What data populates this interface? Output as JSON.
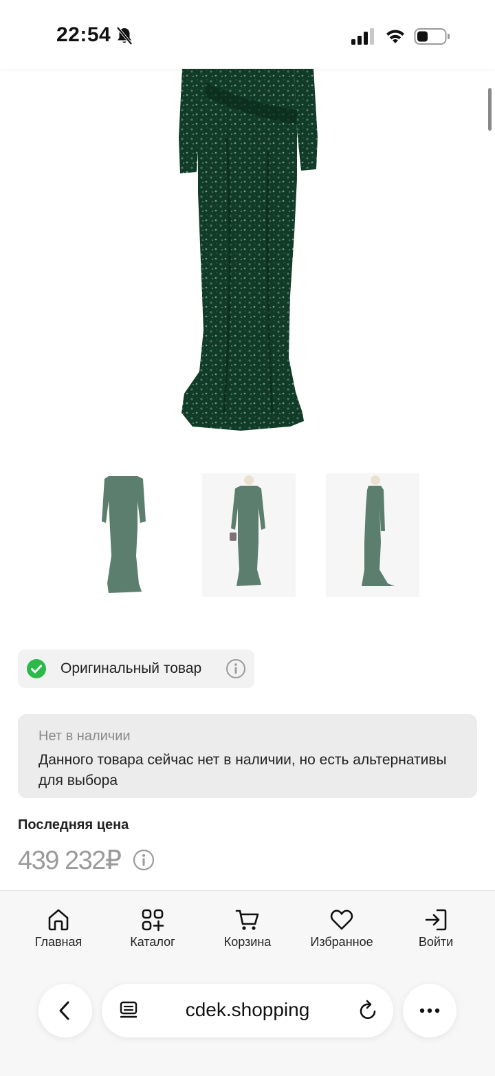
{
  "status_bar": {
    "time": "22:54",
    "icons": [
      "bell-muted-icon",
      "signal-icon",
      "wifi-icon",
      "battery-icon"
    ]
  },
  "product": {
    "main_image": "green-sequin-dress-image",
    "thumbnails": [
      "dress-front-thumbnail",
      "model-front-thumbnail",
      "model-side-thumbnail"
    ],
    "original_badge": {
      "label": "Оригинальный товар",
      "icon": "check-circle-icon",
      "info_icon": "info-icon"
    },
    "stock": {
      "title": "Нет в наличии",
      "description": "Данного товара сейчас нет в наличии, но есть альтернативы для выбора"
    },
    "last_price_label": "Последняя цена",
    "price": "439 232₽"
  },
  "nav": {
    "items": [
      {
        "label": "Главная",
        "icon": "home-icon"
      },
      {
        "label": "Каталог",
        "icon": "catalog-icon"
      },
      {
        "label": "Корзина",
        "icon": "cart-icon"
      },
      {
        "label": "Избранное",
        "icon": "heart-icon"
      },
      {
        "label": "Войти",
        "icon": "login-icon"
      }
    ]
  },
  "browser": {
    "url": "cdek.shopping"
  },
  "colors": {
    "accent_green": "#2db84a",
    "dress_green": "#123a28",
    "muted_text": "#8a8a8a"
  }
}
